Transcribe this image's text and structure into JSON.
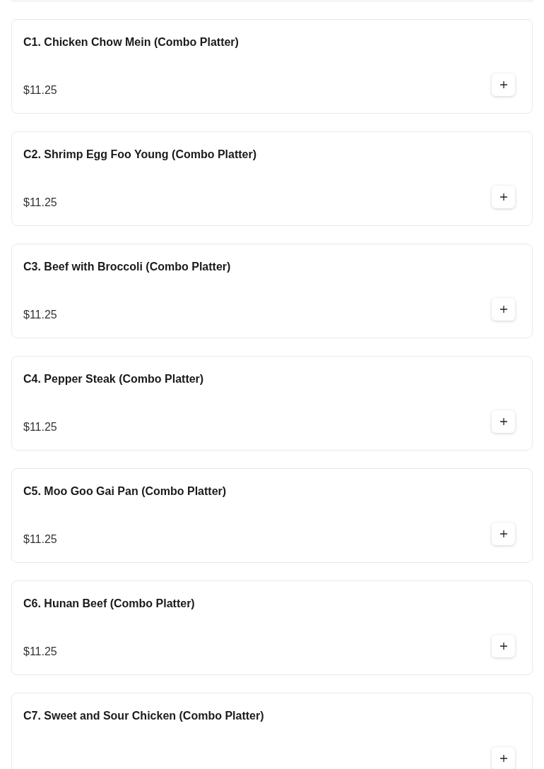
{
  "items": [
    {
      "name": "C1. Chicken Chow Mein (Combo Platter)",
      "price": "$11.25"
    },
    {
      "name": "C2. Shrimp Egg Foo Young (Combo Platter)",
      "price": "$11.25"
    },
    {
      "name": "C3. Beef with Broccoli (Combo Platter)",
      "price": "$11.25"
    },
    {
      "name": "C4. Pepper Steak (Combo Platter)",
      "price": "$11.25"
    },
    {
      "name": "C5. Moo Goo Gai Pan (Combo Platter)",
      "price": "$11.25"
    },
    {
      "name": "C6. Hunan Beef (Combo Platter)",
      "price": "$11.25"
    },
    {
      "name": "C7. Sweet and Sour Chicken (Combo Platter)"
    }
  ]
}
